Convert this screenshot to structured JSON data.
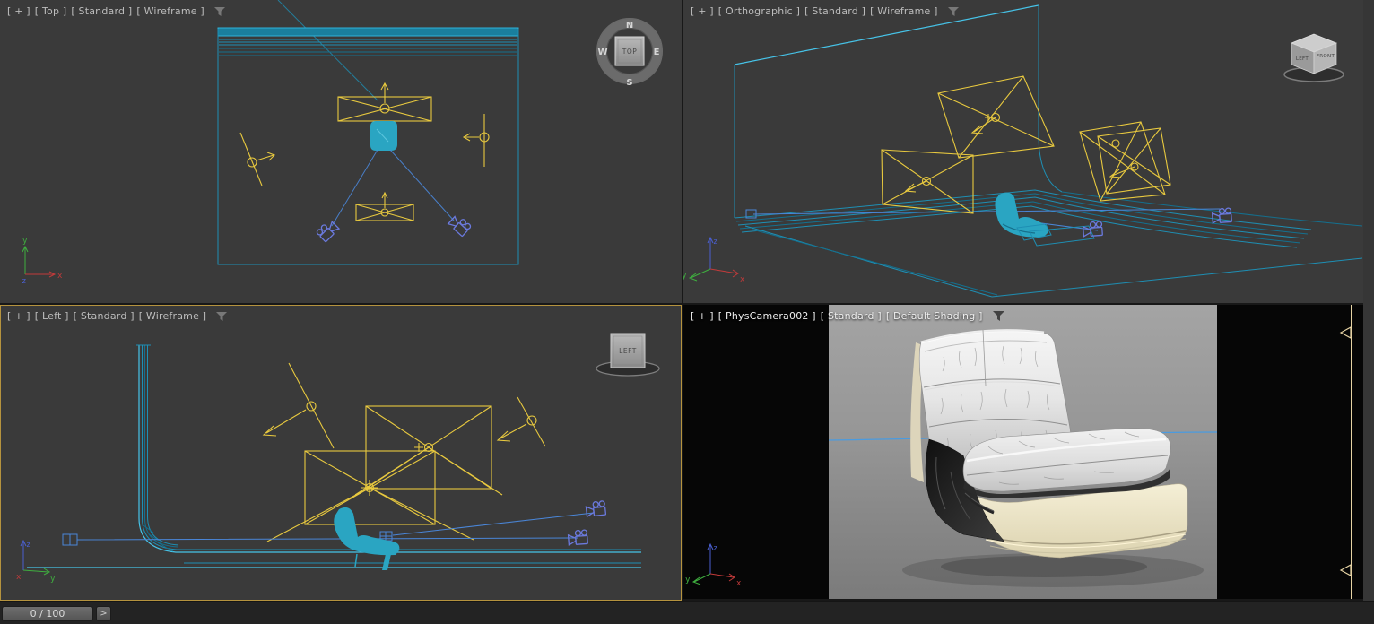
{
  "viewports": {
    "top": {
      "menus": {
        "general": "[ + ]",
        "pov": "[ Top ]",
        "renderer": "[ Standard ]",
        "shading": "[ Wireframe ]"
      }
    },
    "orthographic": {
      "menus": {
        "general": "[ + ]",
        "pov": "[ Orthographic ]",
        "renderer": "[ Standard ]",
        "shading": "[ Wireframe ]"
      }
    },
    "left": {
      "menus": {
        "general": "[ + ]",
        "pov": "[ Left ]",
        "renderer": "[ Standard ]",
        "shading": "[ Wireframe ]"
      }
    },
    "camera": {
      "menus": {
        "general": "[ + ]",
        "pov": "[ PhysCamera002 ]",
        "renderer": "[ Standard ]",
        "shading": "[ Default Shading ]"
      }
    }
  },
  "viewcube": {
    "compass": {
      "n": "N",
      "e": "E",
      "s": "S",
      "w": "W"
    },
    "faces": {
      "top": "TOP",
      "left": "LEFT",
      "front": "FRONT"
    }
  },
  "axes": {
    "x": "x",
    "y": "y",
    "z": "z"
  },
  "timeline": {
    "frame_display": "0 / 100",
    "advance_label": ">"
  },
  "colors": {
    "viewport_background": "#3a3a3a",
    "wireframe_cyan": "#1e8fb4",
    "bright_cyan": "#46c3e8",
    "selected_object_teal": "#2aa5c2",
    "light_gizmo_yellow": "#e8c93f",
    "camera_gizmo_blue": "#6b7ade",
    "target_line_blue": "#4a86d8",
    "active_viewport_border": "#b5933e",
    "camera_frame_line_cream": "#e6d3a4"
  }
}
